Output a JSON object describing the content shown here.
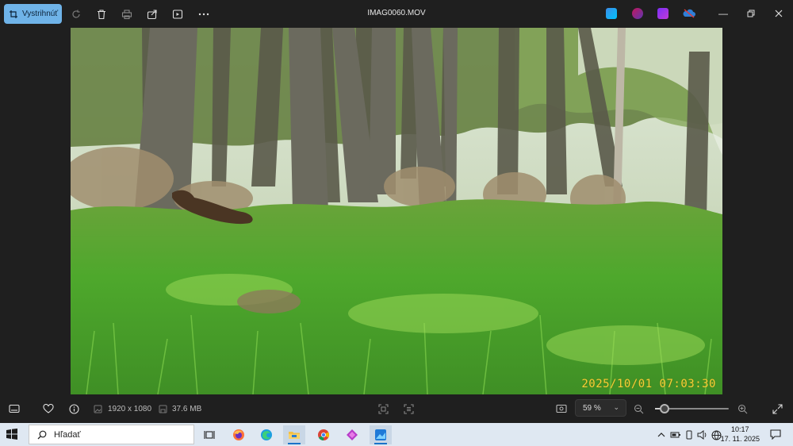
{
  "window": {
    "title": "IMAG0060.MOV",
    "crop_label": "Vystrihnúť"
  },
  "photo": {
    "timestamp": "2025/10/01  07:03:30"
  },
  "status": {
    "dimensions": "1920 x 1080",
    "file_size": "37.6 MB",
    "zoom": "59 %",
    "zoom_level": 0.13
  },
  "taskbar": {
    "search_placeholder": "Hľadať",
    "time": "10:17",
    "date": "17. 11. 2025"
  },
  "colors": {
    "accent": "#6fb3e8",
    "timestamp": "#f2d23a",
    "taskbar": "#dfe8f2"
  }
}
